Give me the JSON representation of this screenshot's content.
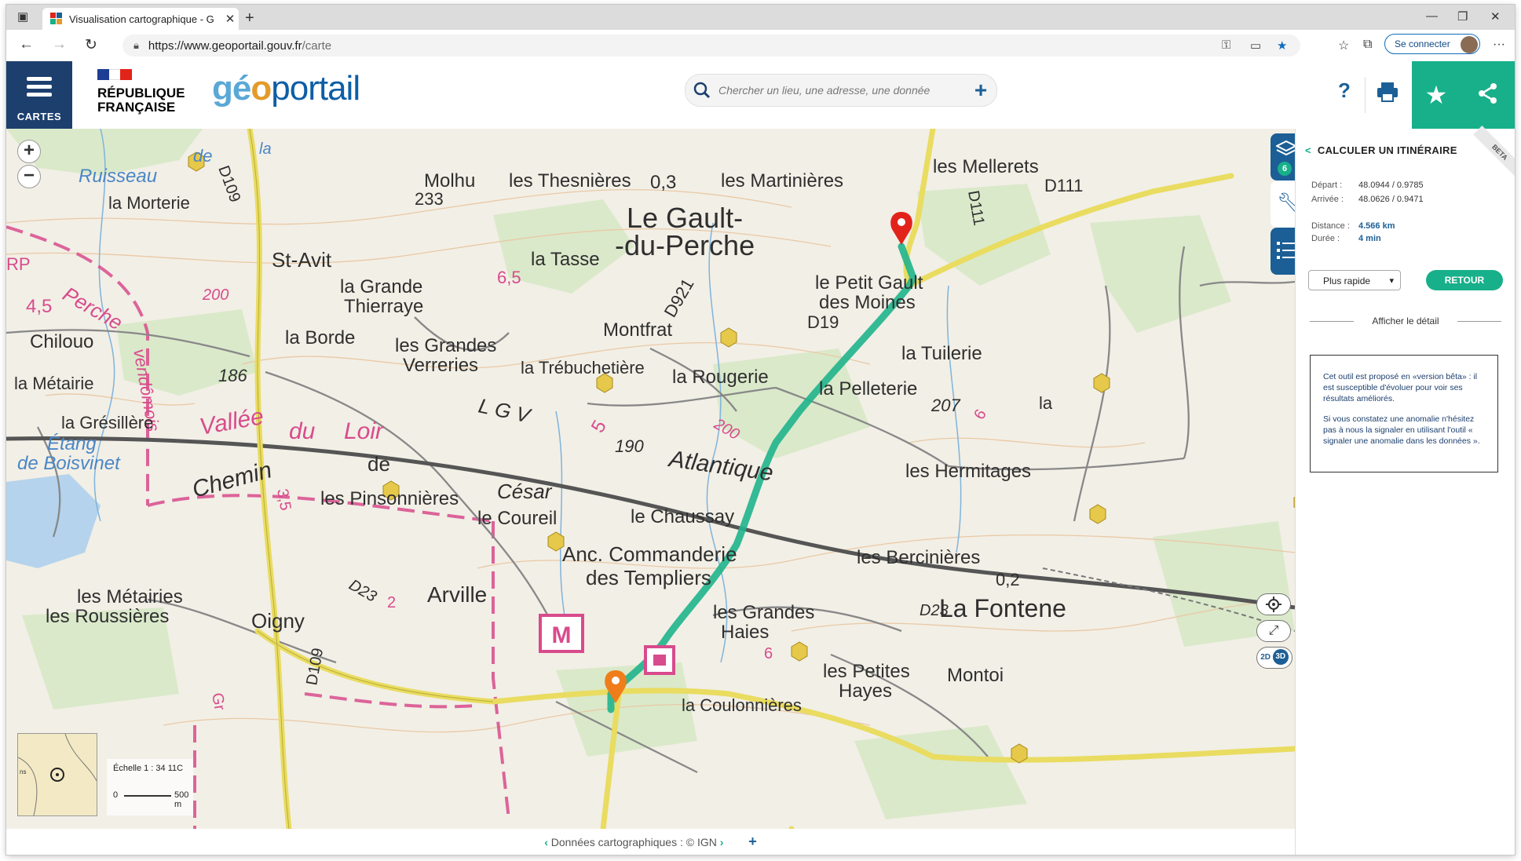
{
  "browser": {
    "tab_title": "Visualisation cartographique - G",
    "url_host": "https://www.geoportail.gouv.fr",
    "url_path": "/carte",
    "signin_label": "Se connecter"
  },
  "header": {
    "menu_label": "CARTES",
    "republic_line1": "RÉPUBLIQUE",
    "republic_line2": "FRANÇAISE",
    "logo_text_1": "gé",
    "logo_text_2": "o",
    "logo_text_3": "portail",
    "search_placeholder": "Chercher un lieu, une adresse, une donnée",
    "help_label": "?"
  },
  "map": {
    "labels": [
      "Ruisseau",
      "de",
      "la",
      "la Morterie",
      "D109",
      "Molhu",
      "233",
      "les Thesnières",
      "0,3",
      "les Martinières",
      "Le Gault-",
      "-du-Perche",
      "les Mellerets",
      "D111",
      "D111",
      "St-Avit",
      "la Grande",
      "Thierraye",
      "la Tasse",
      "6,5",
      "D921",
      "le Petit Gault",
      "des Moines",
      "D19",
      "la Tuilerie",
      "RP",
      "Perche",
      "4,5",
      "200",
      "Chilouo",
      "la Borde",
      "les Grandes",
      "Verreries",
      "Montfrat",
      "la Trébuchetière",
      "la Rougerie",
      "la Pelleterie",
      "207",
      "la",
      "la Métairie",
      "186",
      "vendômois",
      "la Grésillère",
      "Étang",
      "de Boisvinet",
      "Vallée",
      "du",
      "Loir",
      "L G V",
      "5",
      "190",
      "Atlantique",
      "200",
      "6",
      "Chemin",
      "de",
      "3,5",
      "les Pinsonnières",
      "César",
      "le Coureil",
      "le Chaussay",
      "les Hermitages",
      "Anc. Commanderie",
      "des Templiers",
      "les Bercinières",
      "0,2",
      "La Fontene",
      "Arville",
      "D23",
      "2",
      "les Métairies",
      "les Roussières",
      "Oigny",
      "D109",
      "les Grandes",
      "Haies",
      "6",
      "les Petites",
      "Hayes",
      "Montoi",
      "D23",
      "Gr",
      "la Coulonnières"
    ],
    "layers_count": "6",
    "mode_2d": "2D",
    "mode_3d": "3D",
    "scale_label": "Échelle 1 : 34 11C",
    "scale_zero": "0",
    "scale_dist": "500 m",
    "overview_label": "ns"
  },
  "footer": {
    "attribution": "Données cartographiques : © IGN"
  },
  "panel": {
    "title": "CALCULER UN ITINÉRAIRE",
    "beta_label": "BETA",
    "depart_label": "Départ :",
    "depart_value": "48.0944 / 0.9785",
    "arrivee_label": "Arrivée :",
    "arrivee_value": "48.0626 / 0.9471",
    "distance_label": "Distance :",
    "distance_value": "4.566 km",
    "duree_label": "Durée :",
    "duree_value": "4 min",
    "mode_select": "Plus rapide",
    "retour_label": "RETOUR",
    "detail_label": "Afficher le détail",
    "info_p1": "Cet outil est proposé en «version bêta» : il est susceptible d'évoluer pour voir ses résultats améliorés.",
    "info_p2": "Si vous constatez une anomalie n'hésitez pas à nous la signaler en utilisant l'outil « signaler une anomalie dans les données »."
  },
  "colors": {
    "header_blue": "#1c3f6e",
    "accent_green": "#17b08a",
    "route_green": "#1fb48c",
    "marker_red": "#e2231a",
    "marker_orange": "#ef7d1a"
  }
}
